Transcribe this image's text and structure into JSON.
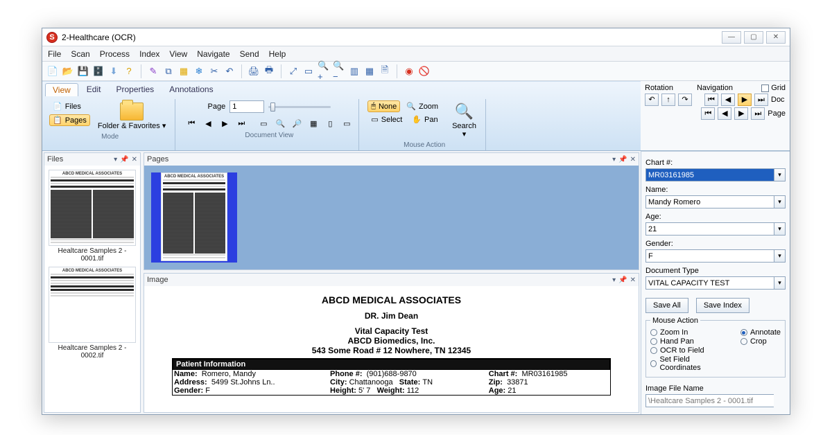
{
  "window": {
    "title": "2-Healthcare (OCR)"
  },
  "menu": [
    "File",
    "Scan",
    "Process",
    "Index",
    "View",
    "Navigate",
    "Send",
    "Help"
  ],
  "ribbon": {
    "tabs": [
      "View",
      "Edit",
      "Properties",
      "Annotations"
    ],
    "mode": {
      "files": "Files",
      "pages": "Pages",
      "folder": "Folder & Favorites ▾",
      "label": "Mode"
    },
    "docview": {
      "page_label": "Page",
      "page_value": "1",
      "label": "Document View"
    },
    "mouse": {
      "none": "None",
      "zoom": "Zoom",
      "select": "Select",
      "pan": "Pan",
      "search": "Search\n▾",
      "label": "Mouse Action"
    }
  },
  "nav": {
    "rotation": "Rotation",
    "navigation": "Navigation",
    "grid": "Grid",
    "doc": "Doc",
    "page": "Page"
  },
  "index": {
    "chartnum_label": "Chart #:",
    "chartnum": "MR03161985",
    "name_label": "Name:",
    "name": "Mandy Romero",
    "age_label": "Age:",
    "age": "21",
    "gender_label": "Gender:",
    "gender": "F",
    "doctype_label": "Document Type",
    "doctype": "VITAL CAPACITY TEST",
    "save_all": "Save All",
    "save_index": "Save Index",
    "mouse_action": "Mouse Action",
    "ma_zoom": "Zoom In",
    "ma_annotate": "Annotate",
    "ma_hand": "Hand Pan",
    "ma_crop": "Crop",
    "ma_ocr": "OCR to Field",
    "ma_setfield": "Set Field Coordinates",
    "imgfile_label": "Image File Name",
    "imgfile": "\\Healtcare Samples 2 - 0001.tif"
  },
  "panes": {
    "files": "Files",
    "pages": "Pages",
    "image": "Image",
    "thumb1": "Healtcare Samples 2 - 0001.tif",
    "thumb2": "Healtcare Samples 2 - 0002.tif"
  },
  "doc": {
    "org": "ABCD MEDICAL ASSOCIATES",
    "dr": "DR. Jim Dean",
    "test": "Vital Capacity Test",
    "company": "ABCD Biomedics, Inc.",
    "addr": "543 Some Road # 12 Nowhere, TN 12345",
    "pi_head": "Patient Information",
    "name_l": "Name:",
    "name_v": "Romero, Mandy",
    "phone_l": "Phone #:",
    "phone_v": "(901)688-9870",
    "chart_l": "Chart #:",
    "chart_v": "MR03161985",
    "addr_l": "Address:",
    "addr_v": "5499 St.Johns Ln..",
    "city_l": "City:",
    "city_v": "Chattanooga",
    "state_l": "State:",
    "state_v": "TN",
    "zip_l": "Zip:",
    "zip_v": "33871",
    "gender_l": "Gender:",
    "gender_v": "F",
    "height_l": "Height:",
    "height_v": "5' 7",
    "weight_l": "Weight:",
    "weight_v": "112",
    "age_l": "Age:",
    "age_v": "21"
  }
}
